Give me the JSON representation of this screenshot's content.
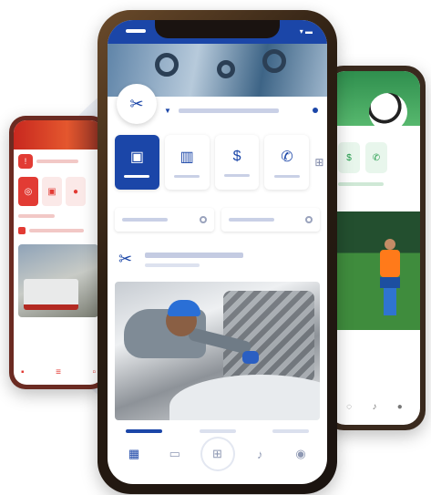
{
  "icons": {
    "left_badge": "alert-icon",
    "left_tiles": [
      "target-icon",
      "briefcase-icon",
      "chat-icon"
    ],
    "left_nav": [
      "home-icon",
      "menu-icon",
      "grid-icon"
    ],
    "right_tiles": [
      "coins-icon",
      "phone-icon"
    ],
    "right_nav": [
      "grid-icon",
      "bell-icon",
      "user-icon"
    ],
    "center_logo": "tools-icon",
    "center_tiles": [
      "dashboard-icon",
      "gift-icon",
      "coins-icon",
      "phone-icon"
    ],
    "center_nav": [
      "home-icon",
      "briefcase-icon",
      "grid-icon",
      "bell-icon",
      "user-icon"
    ]
  },
  "colors": {
    "center_accent": "#1b46a8",
    "left_accent": "#e23b34",
    "right_accent": "#1f9a48"
  }
}
